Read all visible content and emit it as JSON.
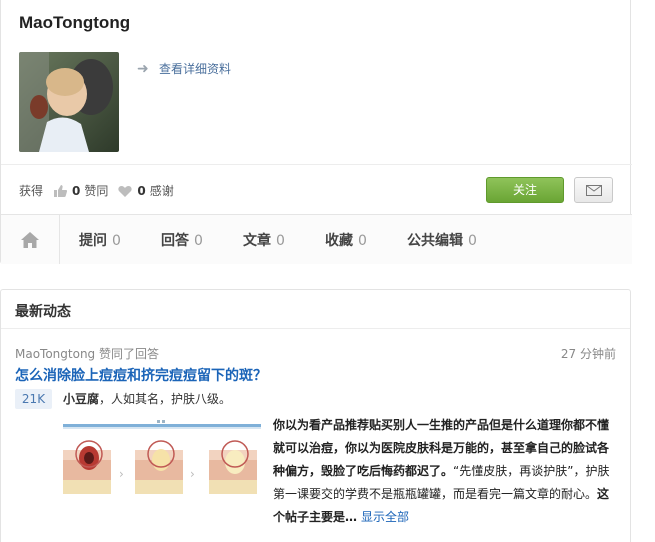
{
  "profile": {
    "name": "MaoTongtong",
    "detail_link": "查看详细资料"
  },
  "stats": {
    "label_get": "获得",
    "upvotes": "0",
    "upvotes_label": "赞同",
    "thanks": "0",
    "thanks_label": "感谢"
  },
  "actions": {
    "follow_label": "关注"
  },
  "tabs": [
    {
      "label": "提问",
      "count": "0"
    },
    {
      "label": "回答",
      "count": "0"
    },
    {
      "label": "文章",
      "count": "0"
    },
    {
      "label": "收藏",
      "count": "0"
    },
    {
      "label": "公共编辑",
      "count": "0"
    }
  ],
  "activity": {
    "section_title": "最新动态",
    "meta": "MaoTongtong 赞同了回答",
    "time": "27 分钟前",
    "question": "怎么消除脸上痘痘和挤完痘痘留下的斑？",
    "votes": "21K",
    "author_name": "小豆腐",
    "author_bio": "，人如其名，护肤八级。",
    "answer_bold": "你以为看产品推荐贴买别人一生推的产品但是什么道理你都不懂就可以治痘，你以为医院皮肤科是万能的，甚至拿自己的脸试各种偏方，毁脸了吃后悔药都迟了。",
    "answer_normal": "“先懂皮肤，再谈护肤”，护肤第一课要交的学费不是瓶瓶罐罐，而是看完一篇文章的耐心。",
    "answer_tail": "这个帖子主要是…",
    "show_all": "显示全部"
  },
  "colors": {
    "link": "#1b64b8",
    "follow_green": "#6aa534",
    "badge_bg": "#eaf0f8"
  }
}
